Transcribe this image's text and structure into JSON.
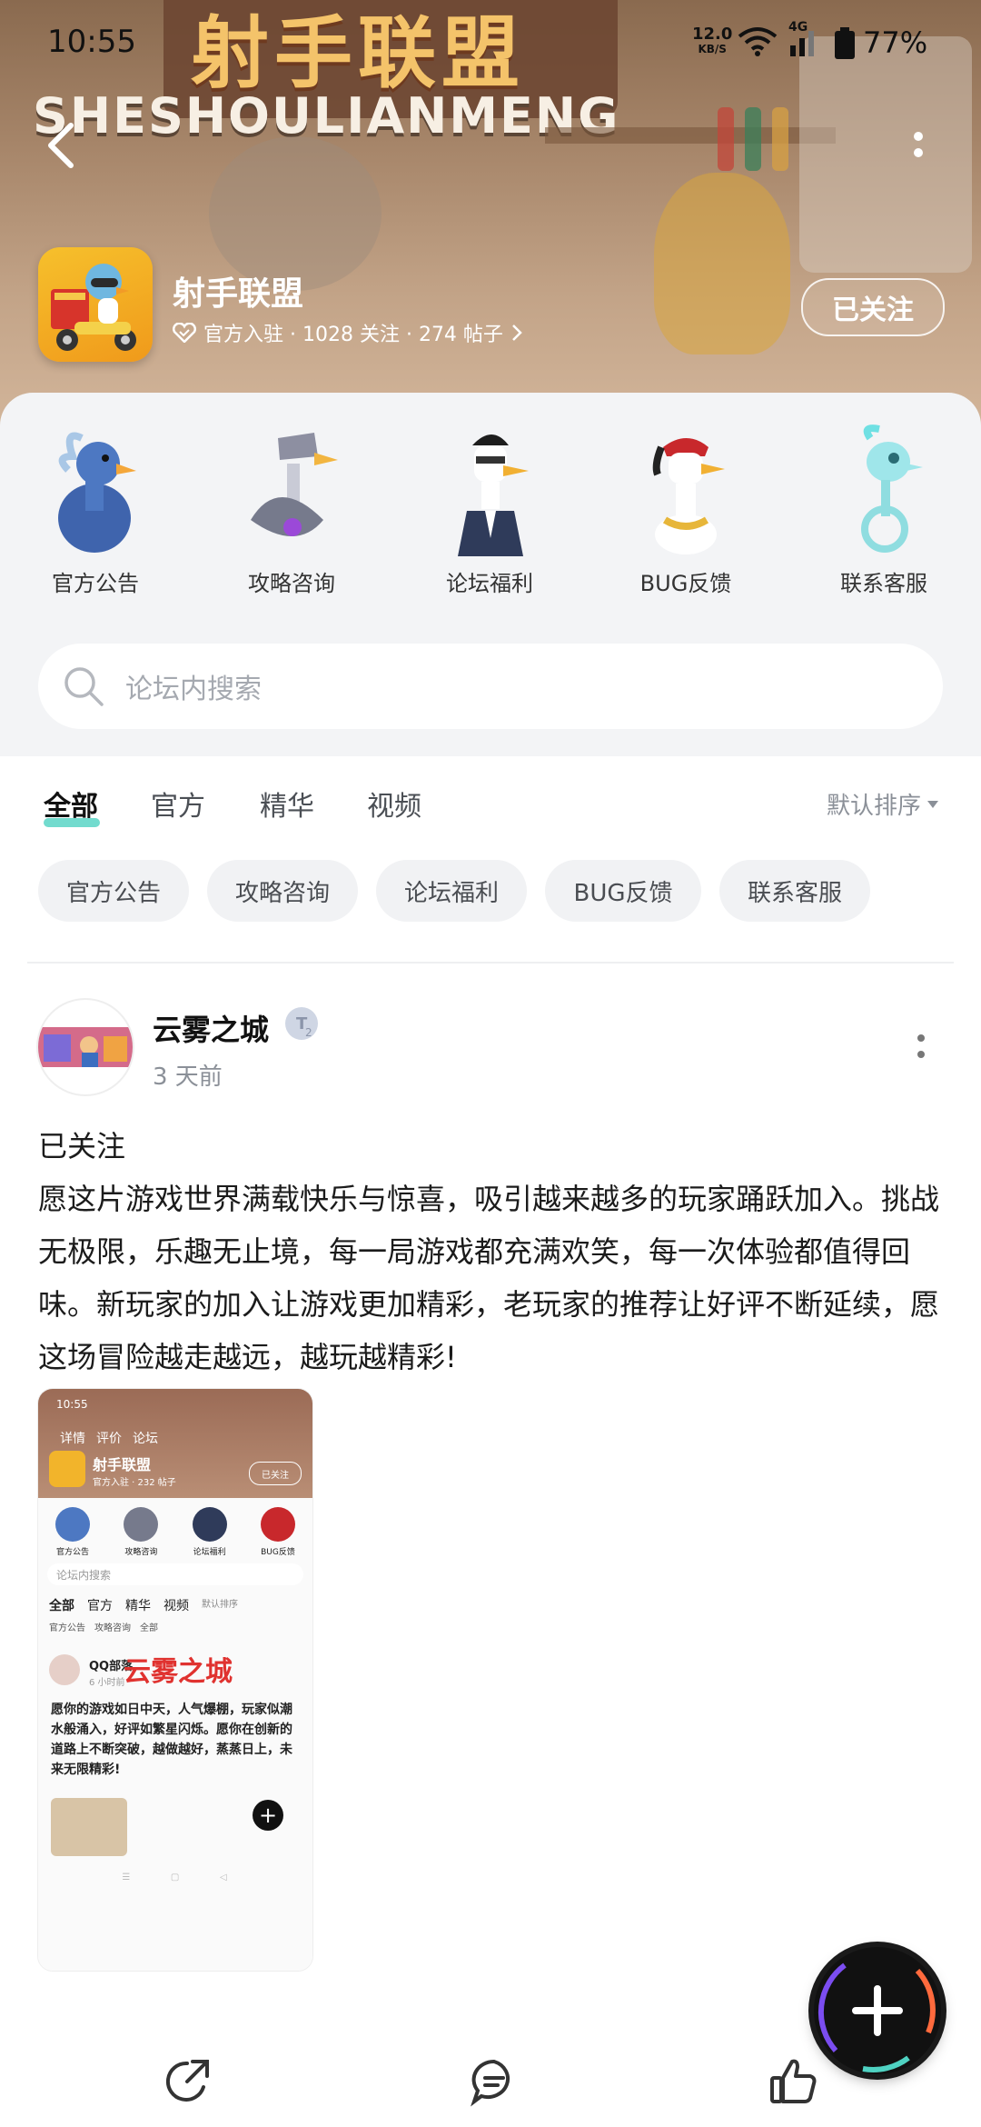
{
  "status": {
    "time": "10:55",
    "net_speed_value": "12.0",
    "net_speed_unit": "KB/S",
    "network": "4G",
    "battery": "77%"
  },
  "header": {
    "banner_title": "射手联盟",
    "banner_sub": "SHESHOULIANMENG",
    "app_name": "射手联盟",
    "meta": "官方入驻 · 1028 关注 · 274 帖子",
    "follow_label": "已关注"
  },
  "categories": [
    {
      "label": "官方公告",
      "icon": "blue-goose-icon"
    },
    {
      "label": "攻略咨询",
      "icon": "robot-goose-icon"
    },
    {
      "label": "论坛福利",
      "icon": "suit-goose-icon"
    },
    {
      "label": "BUG反馈",
      "icon": "bandana-goose-icon"
    },
    {
      "label": "联系客服",
      "icon": "skeleton-goose-icon"
    }
  ],
  "search": {
    "placeholder": "论坛内搜索"
  },
  "tabs": [
    "全部",
    "官方",
    "精华",
    "视频"
  ],
  "sort_label": "默认排序",
  "chips": [
    "官方公告",
    "攻略咨询",
    "论坛福利",
    "BUG反馈",
    "联系客服"
  ],
  "post": {
    "author": "云雾之城",
    "level": "2",
    "time": "3 天前",
    "line1": "已关注",
    "body": "愿这片游戏世界满载快乐与惊喜，吸引越来越多的玩家踊跃加入。挑战无极限，乐趣无止境，每一局游戏都充满欢笑，每一次体验都值得回味。新玩家的加入让游戏更加精彩，老玩家的推荐让好评不断延续，愿这场冒险越走越远，越玩越精彩!"
  },
  "thumbnail": {
    "time": "10:55",
    "nav": [
      "详情",
      "评价",
      "论坛"
    ],
    "app_name": "射手联盟",
    "meta": "官方入驻 · 232 帖子",
    "follow": "已关注",
    "cats": [
      "官方公告",
      "攻略咨询",
      "论坛福利",
      "BUG反馈"
    ],
    "search": "论坛内搜索",
    "tabs": [
      "全部",
      "官方",
      "精华",
      "视频"
    ],
    "sort": "默认排序",
    "chips": [
      "官方公告",
      "攻略咨询",
      "全部"
    ],
    "author": "QQ部落",
    "overlay": "云雾之城",
    "time_ago": "6 小时前",
    "text": "愿你的游戏如日中天，人气爆棚，玩家似潮水般涌入，好评如繁星闪烁。愿你在创新的道路上不断突破，越做越好，蒸蒸日上，未来无限精彩!"
  },
  "colors": {
    "accent": "#4fd2c2",
    "chip_bg": "#f1f2f4",
    "card_bg": "#f3f4f6",
    "overlay_red": "#e0322f"
  }
}
